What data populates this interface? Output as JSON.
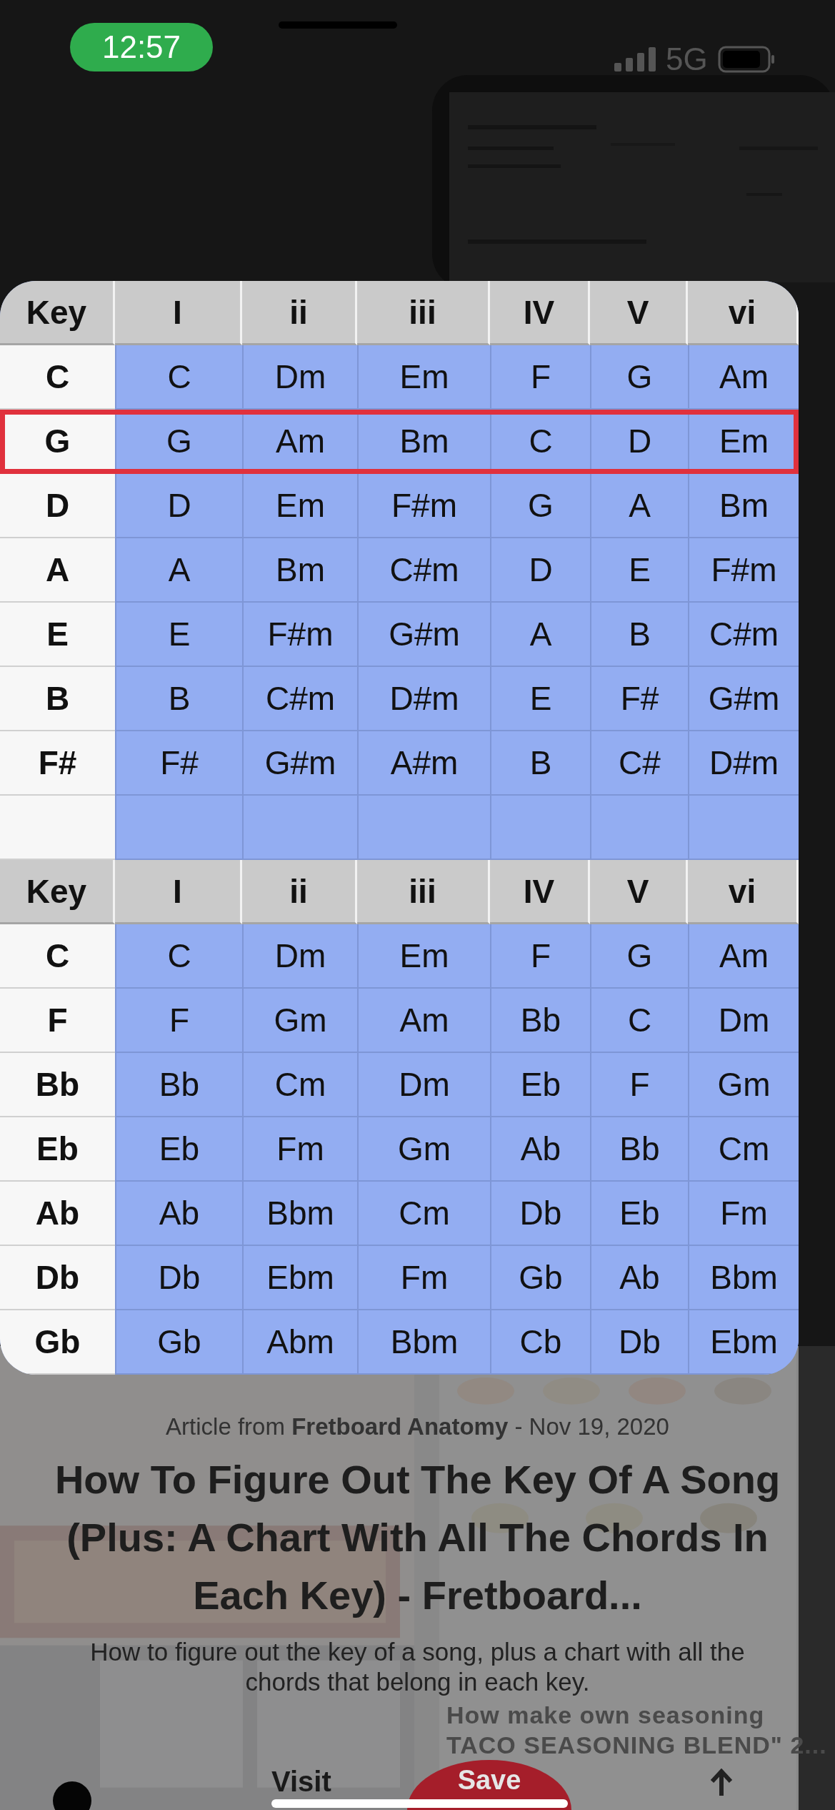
{
  "status_bar": {
    "time": "12:57",
    "network": "5G"
  },
  "chord_tables": [
    {
      "header": [
        "Key",
        "I",
        "ii",
        "iii",
        "IV",
        "V",
        "vi"
      ],
      "rows": [
        {
          "key": "C",
          "chords": [
            "C",
            "Dm",
            "Em",
            "F",
            "G",
            "Am"
          ],
          "highlighted": false
        },
        {
          "key": "G",
          "chords": [
            "G",
            "Am",
            "Bm",
            "C",
            "D",
            "Em"
          ],
          "highlighted": true
        },
        {
          "key": "D",
          "chords": [
            "D",
            "Em",
            "F#m",
            "G",
            "A",
            "Bm"
          ],
          "highlighted": false
        },
        {
          "key": "A",
          "chords": [
            "A",
            "Bm",
            "C#m",
            "D",
            "E",
            "F#m"
          ],
          "highlighted": false
        },
        {
          "key": "E",
          "chords": [
            "E",
            "F#m",
            "G#m",
            "A",
            "B",
            "C#m"
          ],
          "highlighted": false
        },
        {
          "key": "B",
          "chords": [
            "B",
            "C#m",
            "D#m",
            "E",
            "F#",
            "G#m"
          ],
          "highlighted": false
        },
        {
          "key": "F#",
          "chords": [
            "F#",
            "G#m",
            "A#m",
            "B",
            "C#",
            "D#m"
          ],
          "highlighted": false
        },
        {
          "kind": "blank"
        }
      ]
    },
    {
      "header": [
        "Key",
        "I",
        "ii",
        "iii",
        "IV",
        "V",
        "vi"
      ],
      "rows": [
        {
          "key": "C",
          "chords": [
            "C",
            "Dm",
            "Em",
            "F",
            "G",
            "Am"
          ],
          "highlighted": false
        },
        {
          "key": "F",
          "chords": [
            "F",
            "Gm",
            "Am",
            "Bb",
            "C",
            "Dm"
          ],
          "highlighted": false
        },
        {
          "key": "Bb",
          "chords": [
            "Bb",
            "Cm",
            "Dm",
            "Eb",
            "F",
            "Gm"
          ],
          "highlighted": false
        },
        {
          "key": "Eb",
          "chords": [
            "Eb",
            "Fm",
            "Gm",
            "Ab",
            "Bb",
            "Cm"
          ],
          "highlighted": false
        },
        {
          "key": "Ab",
          "chords": [
            "Ab",
            "Bbm",
            "Cm",
            "Db",
            "Eb",
            "Fm"
          ],
          "highlighted": false
        },
        {
          "key": "Db",
          "chords": [
            "Db",
            "Ebm",
            "Fm",
            "Gb",
            "Ab",
            "Bbm"
          ],
          "highlighted": false
        },
        {
          "key": "Gb",
          "chords": [
            "Gb",
            "Abm",
            "Bbm",
            "Cb",
            "Db",
            "Ebm"
          ],
          "highlighted": false
        }
      ]
    }
  ],
  "article": {
    "source_line": "Article from **Fretboard Anatomy** - Nov 19, 2020",
    "title": "How To Figure Out The Key Of A Song (Plus: A Chart With All The Chords In Each Key) - Fretboard...",
    "description": "How to figure out the key of a song, plus a chart with all the chords that belong in each key."
  },
  "background_pin": {
    "title_lines": [
      "How make own seasoning",
      "TACO SEASONING BLEND\" 2..."
    ]
  },
  "actions": [
    {
      "label": "Visit",
      "kind": "text"
    },
    {
      "label": "Save",
      "kind": "primary"
    }
  ]
}
